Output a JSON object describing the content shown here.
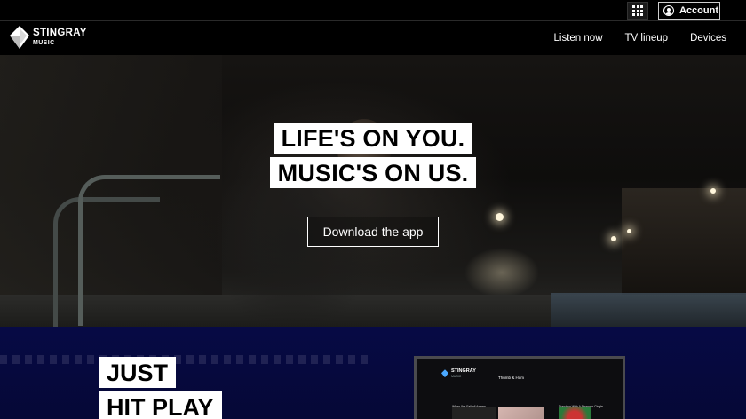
{
  "utility_bar": {
    "apps_icon": "grid-icon",
    "account_label": "Account",
    "account_icon": "user-circle-icon"
  },
  "brand": {
    "name": "STINGRAY",
    "sub": "MUSIC",
    "logo_icon": "stingray-diamond-icon"
  },
  "nav": {
    "items": [
      {
        "label": "Listen now"
      },
      {
        "label": "TV lineup"
      },
      {
        "label": "Devices"
      }
    ]
  },
  "hero": {
    "headline_lines": [
      "LIFE'S ON YOU.",
      "MUSIC'S ON US."
    ],
    "cta_label": "Download the app"
  },
  "play_section": {
    "title_lines": [
      "JUST",
      "HIT PLAY"
    ]
  },
  "tv_preview": {
    "brand": "STINGRAY",
    "brand_sub": "MUSIC",
    "now_playing_title": "Thumb & Hum",
    "card_left": "When We Fall all Asleep...",
    "card_right": "Standing With A Stranger Cingle"
  },
  "colors": {
    "background": "#000000",
    "lower_section": "#070a45",
    "headline_bg": "#ffffff",
    "headline_text": "#000000",
    "accent_blue": "#4aa8ff"
  }
}
